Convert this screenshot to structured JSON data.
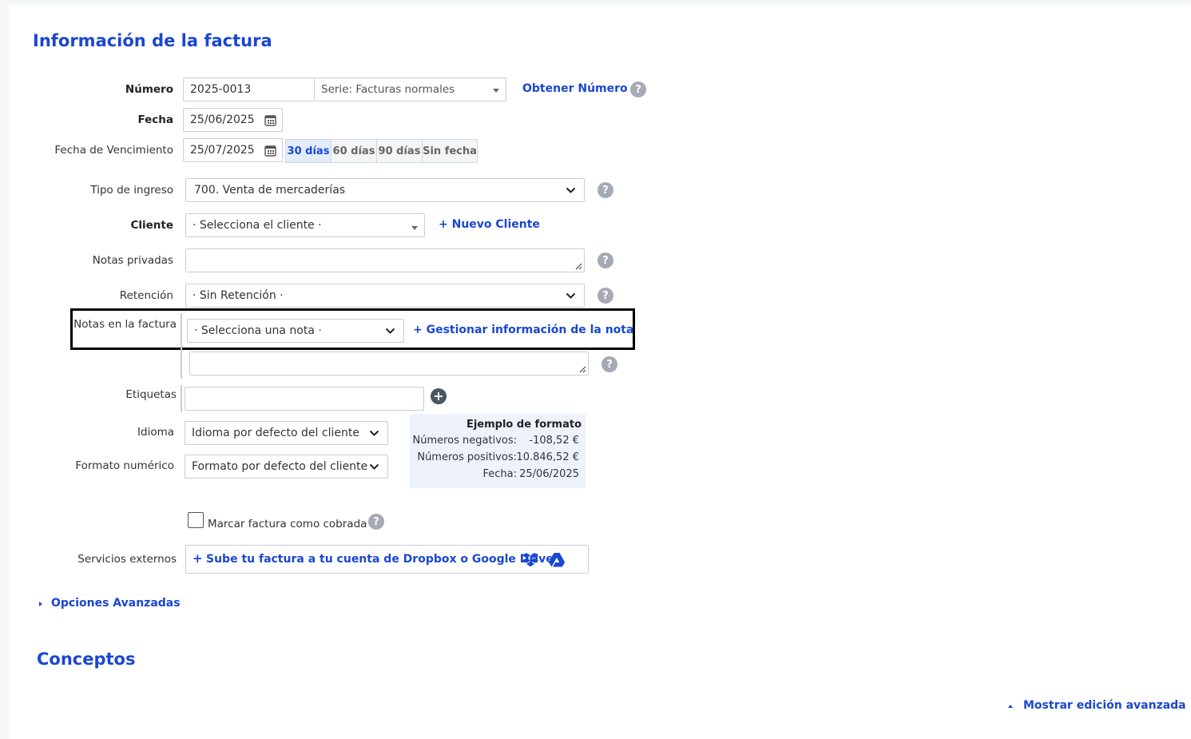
{
  "section_title": "Información de la factura",
  "numero": {
    "label": "Número",
    "value": "2025-0013",
    "serie": "Serie: Facturas normales",
    "obtener": "Obtener Número"
  },
  "fecha": {
    "label": "Fecha",
    "value": "25/06/2025"
  },
  "vencimiento": {
    "label": "Fecha de Vencimiento",
    "value": "25/07/2025",
    "chips": [
      "30 días",
      "60 días",
      "90 días",
      "Sin fecha"
    ],
    "active_chip": "30 días"
  },
  "tipo_ingreso": {
    "label": "Tipo de ingreso",
    "value": "700. Venta de mercaderías"
  },
  "cliente": {
    "label": "Cliente",
    "placeholder": "· Selecciona el cliente ·",
    "nuevo": "+ Nuevo Cliente"
  },
  "notas_privadas": {
    "label": "Notas privadas",
    "value": ""
  },
  "retencion": {
    "label": "Retención",
    "value": "· Sin Retención ·"
  },
  "notas_factura": {
    "label": "Notas en la factura",
    "placeholder": "· Selecciona una nota ·",
    "gestionar": "+ Gestionar información de la nota",
    "value": ""
  },
  "etiquetas": {
    "label": "Etiquetas",
    "value": ""
  },
  "idioma": {
    "label": "Idioma",
    "value": "Idioma por defecto del cliente"
  },
  "formato": {
    "label": "Formato numérico",
    "value": "Formato por defecto del cliente"
  },
  "ejemplo": {
    "title": "Ejemplo de formato",
    "negativos_label": "Números negativos:",
    "negativos_value": "-108,52 €",
    "positivos_label": "Números positivos:",
    "positivos_value": "10.846,52 €",
    "fecha_label": "Fecha:",
    "fecha_value": "25/06/2025"
  },
  "cobrada": {
    "label": "Marcar factura como cobrada",
    "checked": false
  },
  "servicios": {
    "label": "Servicios externos",
    "button": "Sube tu factura a tu cuenta de Dropbox o Google Drive",
    "plus": "+"
  },
  "opciones": "Opciones Avanzadas",
  "conceptos_title": "Conceptos",
  "mostrar": "Mostrar edición avanzada",
  "help_glyph": "?",
  "colors": {
    "accent": "#1a47d1",
    "help": "#a5aab3",
    "format_bg": "#edf2fb"
  }
}
